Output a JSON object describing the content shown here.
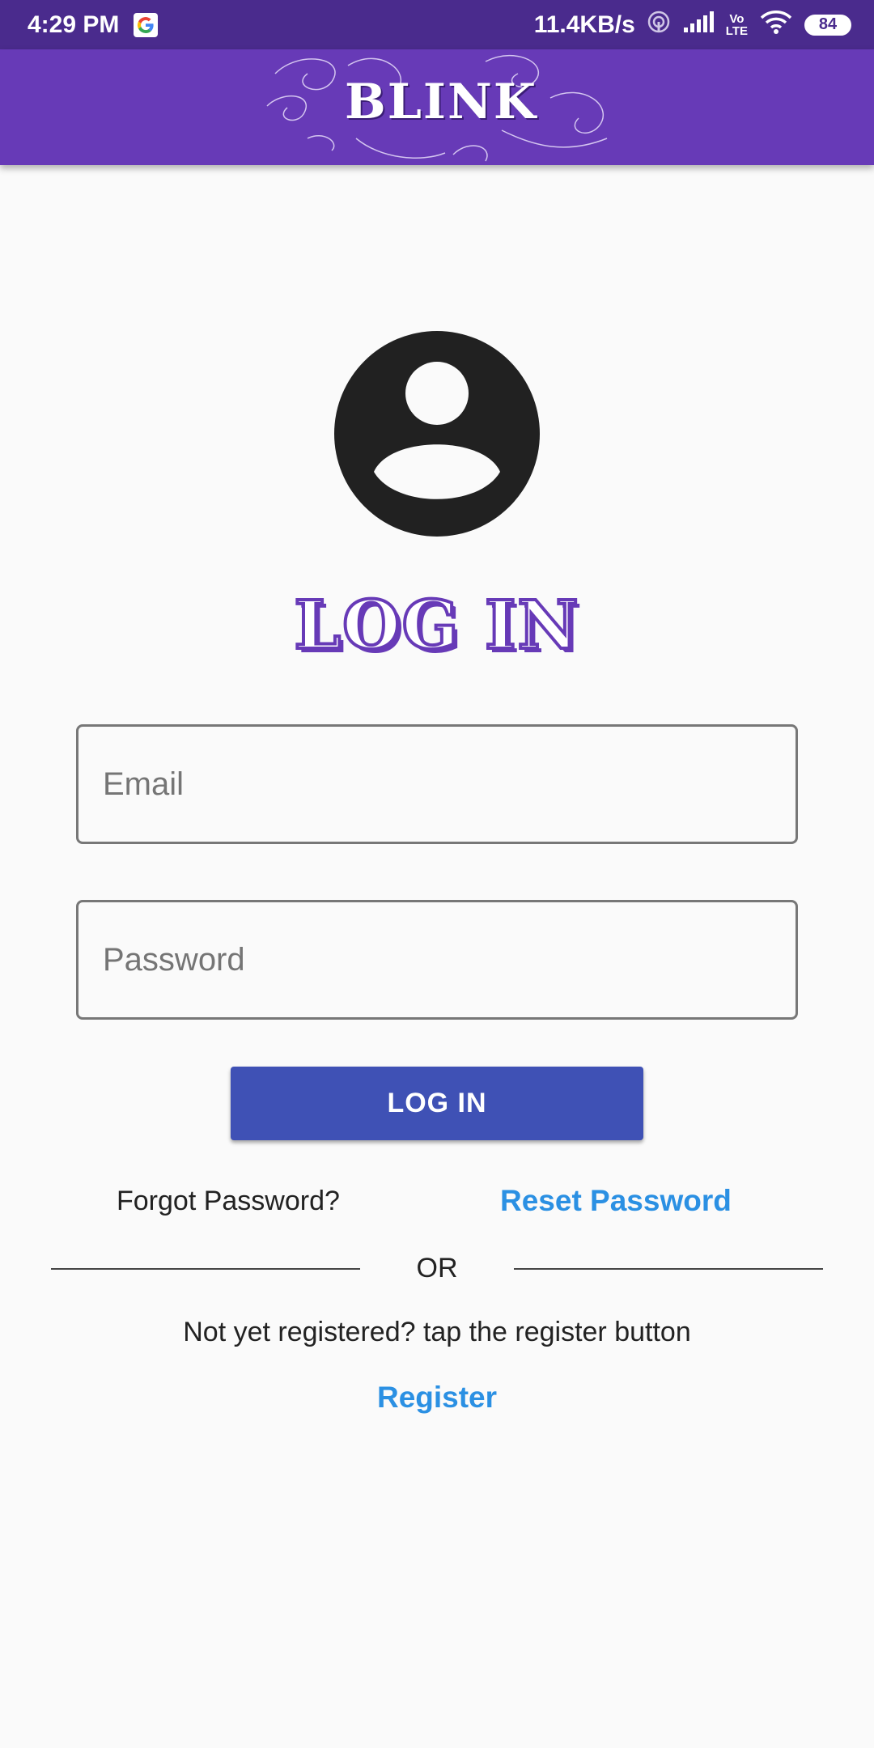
{
  "status_bar": {
    "time": "4:29 PM",
    "network_speed": "11.4KB/s",
    "volte_label_top": "Vo",
    "volte_label_bottom": "LTE",
    "battery_level": "84",
    "icons": [
      "google-icon",
      "hotspot-icon",
      "signal-icon",
      "wifi-icon",
      "battery-icon"
    ]
  },
  "app_bar": {
    "logo_text": "BLINK",
    "background_color": "#673ab7"
  },
  "login": {
    "title": "LOG IN",
    "email_placeholder": "Email",
    "password_placeholder": "Password",
    "button_label": "LOG IN",
    "forgot_label": "Forgot Password?",
    "reset_link": "Reset Password",
    "or_text": "OR",
    "not_registered_text": "Not yet registered? tap the register button",
    "register_link": "Register"
  },
  "colors": {
    "status_bar": "#4a2b8d",
    "primary": "#673ab7",
    "button": "#3f51b5",
    "link": "#2b90e3",
    "avatar": "#212121"
  }
}
